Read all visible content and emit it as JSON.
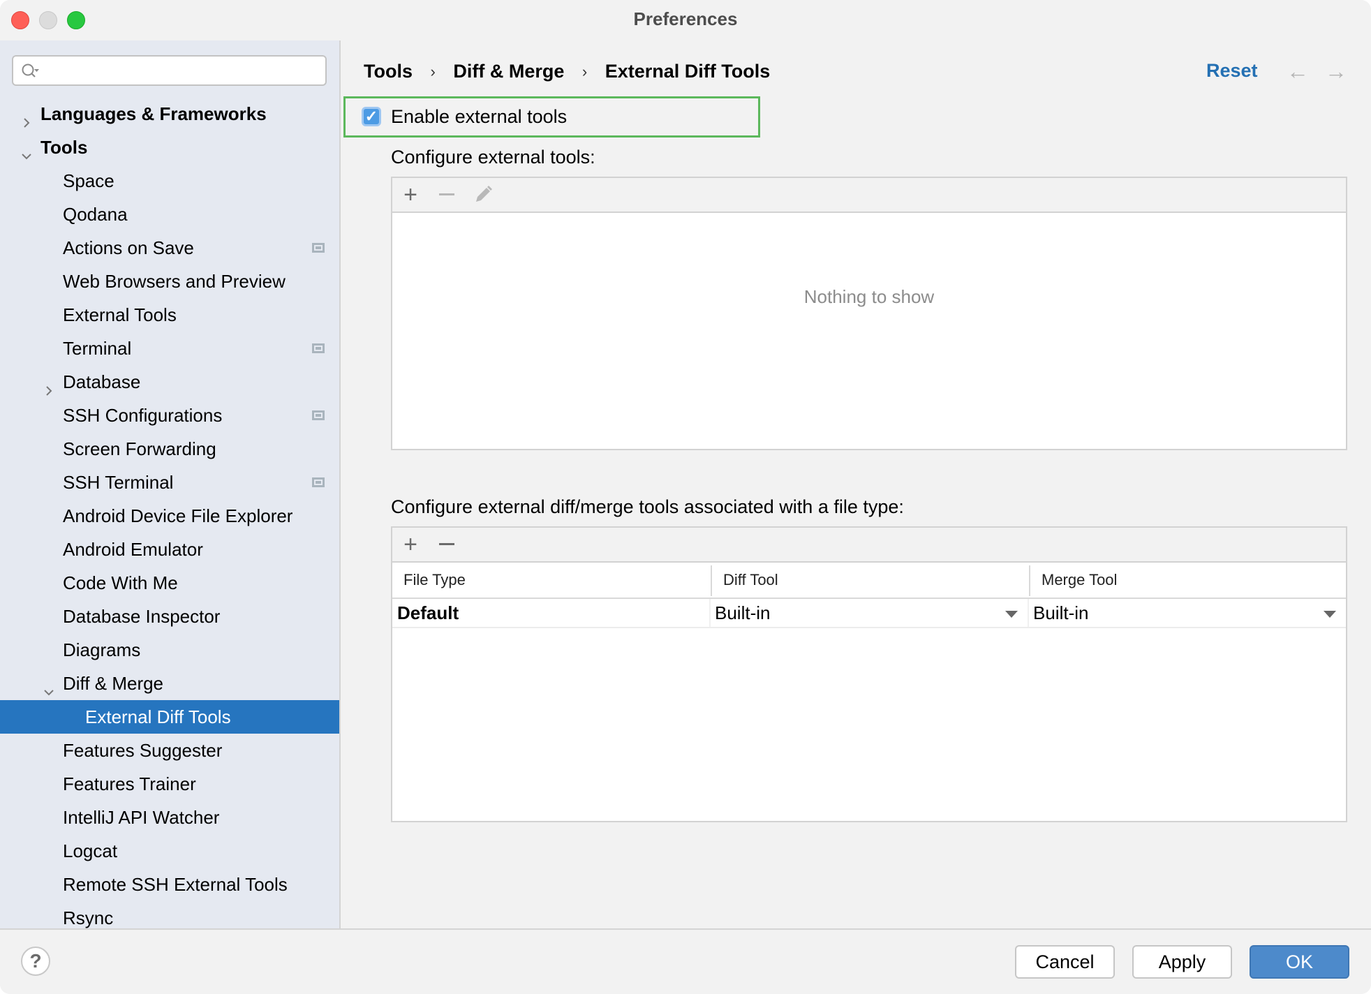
{
  "window": {
    "title": "Preferences"
  },
  "sidebar": {
    "search": {
      "value": "",
      "placeholder": ""
    },
    "items": [
      {
        "label": "Languages & Frameworks",
        "level": 0,
        "expander": "collapsed",
        "bold": true
      },
      {
        "label": "Tools",
        "level": 0,
        "expander": "expanded",
        "bold": true
      },
      {
        "label": "Space",
        "level": 1
      },
      {
        "label": "Qodana",
        "level": 1
      },
      {
        "label": "Actions on Save",
        "level": 1,
        "badge": true
      },
      {
        "label": "Web Browsers and Preview",
        "level": 1
      },
      {
        "label": "External Tools",
        "level": 1
      },
      {
        "label": "Terminal",
        "level": 1,
        "badge": true
      },
      {
        "label": "Database",
        "level": 1,
        "expander": "collapsed"
      },
      {
        "label": "SSH Configurations",
        "level": 1,
        "badge": true
      },
      {
        "label": "Screen Forwarding",
        "level": 1
      },
      {
        "label": "SSH Terminal",
        "level": 1,
        "badge": true
      },
      {
        "label": "Android Device File Explorer",
        "level": 1
      },
      {
        "label": "Android Emulator",
        "level": 1
      },
      {
        "label": "Code With Me",
        "level": 1
      },
      {
        "label": "Database Inspector",
        "level": 1
      },
      {
        "label": "Diagrams",
        "level": 1
      },
      {
        "label": "Diff & Merge",
        "level": 1,
        "expander": "expanded"
      },
      {
        "label": "External Diff Tools",
        "level": 2,
        "selected": true
      },
      {
        "label": "Features Suggester",
        "level": 1
      },
      {
        "label": "Features Trainer",
        "level": 1
      },
      {
        "label": "IntelliJ API Watcher",
        "level": 1
      },
      {
        "label": "Logcat",
        "level": 1
      },
      {
        "label": "Remote SSH External Tools",
        "level": 1
      },
      {
        "label": "Rsync",
        "level": 1
      }
    ]
  },
  "header": {
    "breadcrumb": [
      "Tools",
      "Diff & Merge",
      "External Diff Tools"
    ],
    "breadcrumb_separator": "›",
    "reset_label": "Reset",
    "back_icon": "←",
    "forward_icon": "→"
  },
  "main": {
    "enable_checkbox": {
      "label": "Enable external tools",
      "checked": true,
      "check_glyph": "✓"
    },
    "tools_section": {
      "label": "Configure external tools:",
      "toolbar": {
        "add": "+",
        "remove": "−"
      },
      "empty_text": "Nothing to show"
    },
    "filetype_section": {
      "label": "Configure external diff/merge tools associated with a file type:",
      "toolbar": {
        "add": "+",
        "remove": "−"
      },
      "columns": [
        "File Type",
        "Diff Tool",
        "Merge Tool"
      ],
      "rows": [
        {
          "file_type": "Default",
          "diff_tool": "Built-in",
          "merge_tool": "Built-in"
        }
      ]
    }
  },
  "footer": {
    "help_glyph": "?",
    "cancel_label": "Cancel",
    "apply_label": "Apply",
    "ok_label": "OK"
  },
  "colors": {
    "accent": "#2675bf",
    "link": "#2470b3",
    "highlight_box": "#5cb85c",
    "ok_button": "#4d8acb"
  }
}
